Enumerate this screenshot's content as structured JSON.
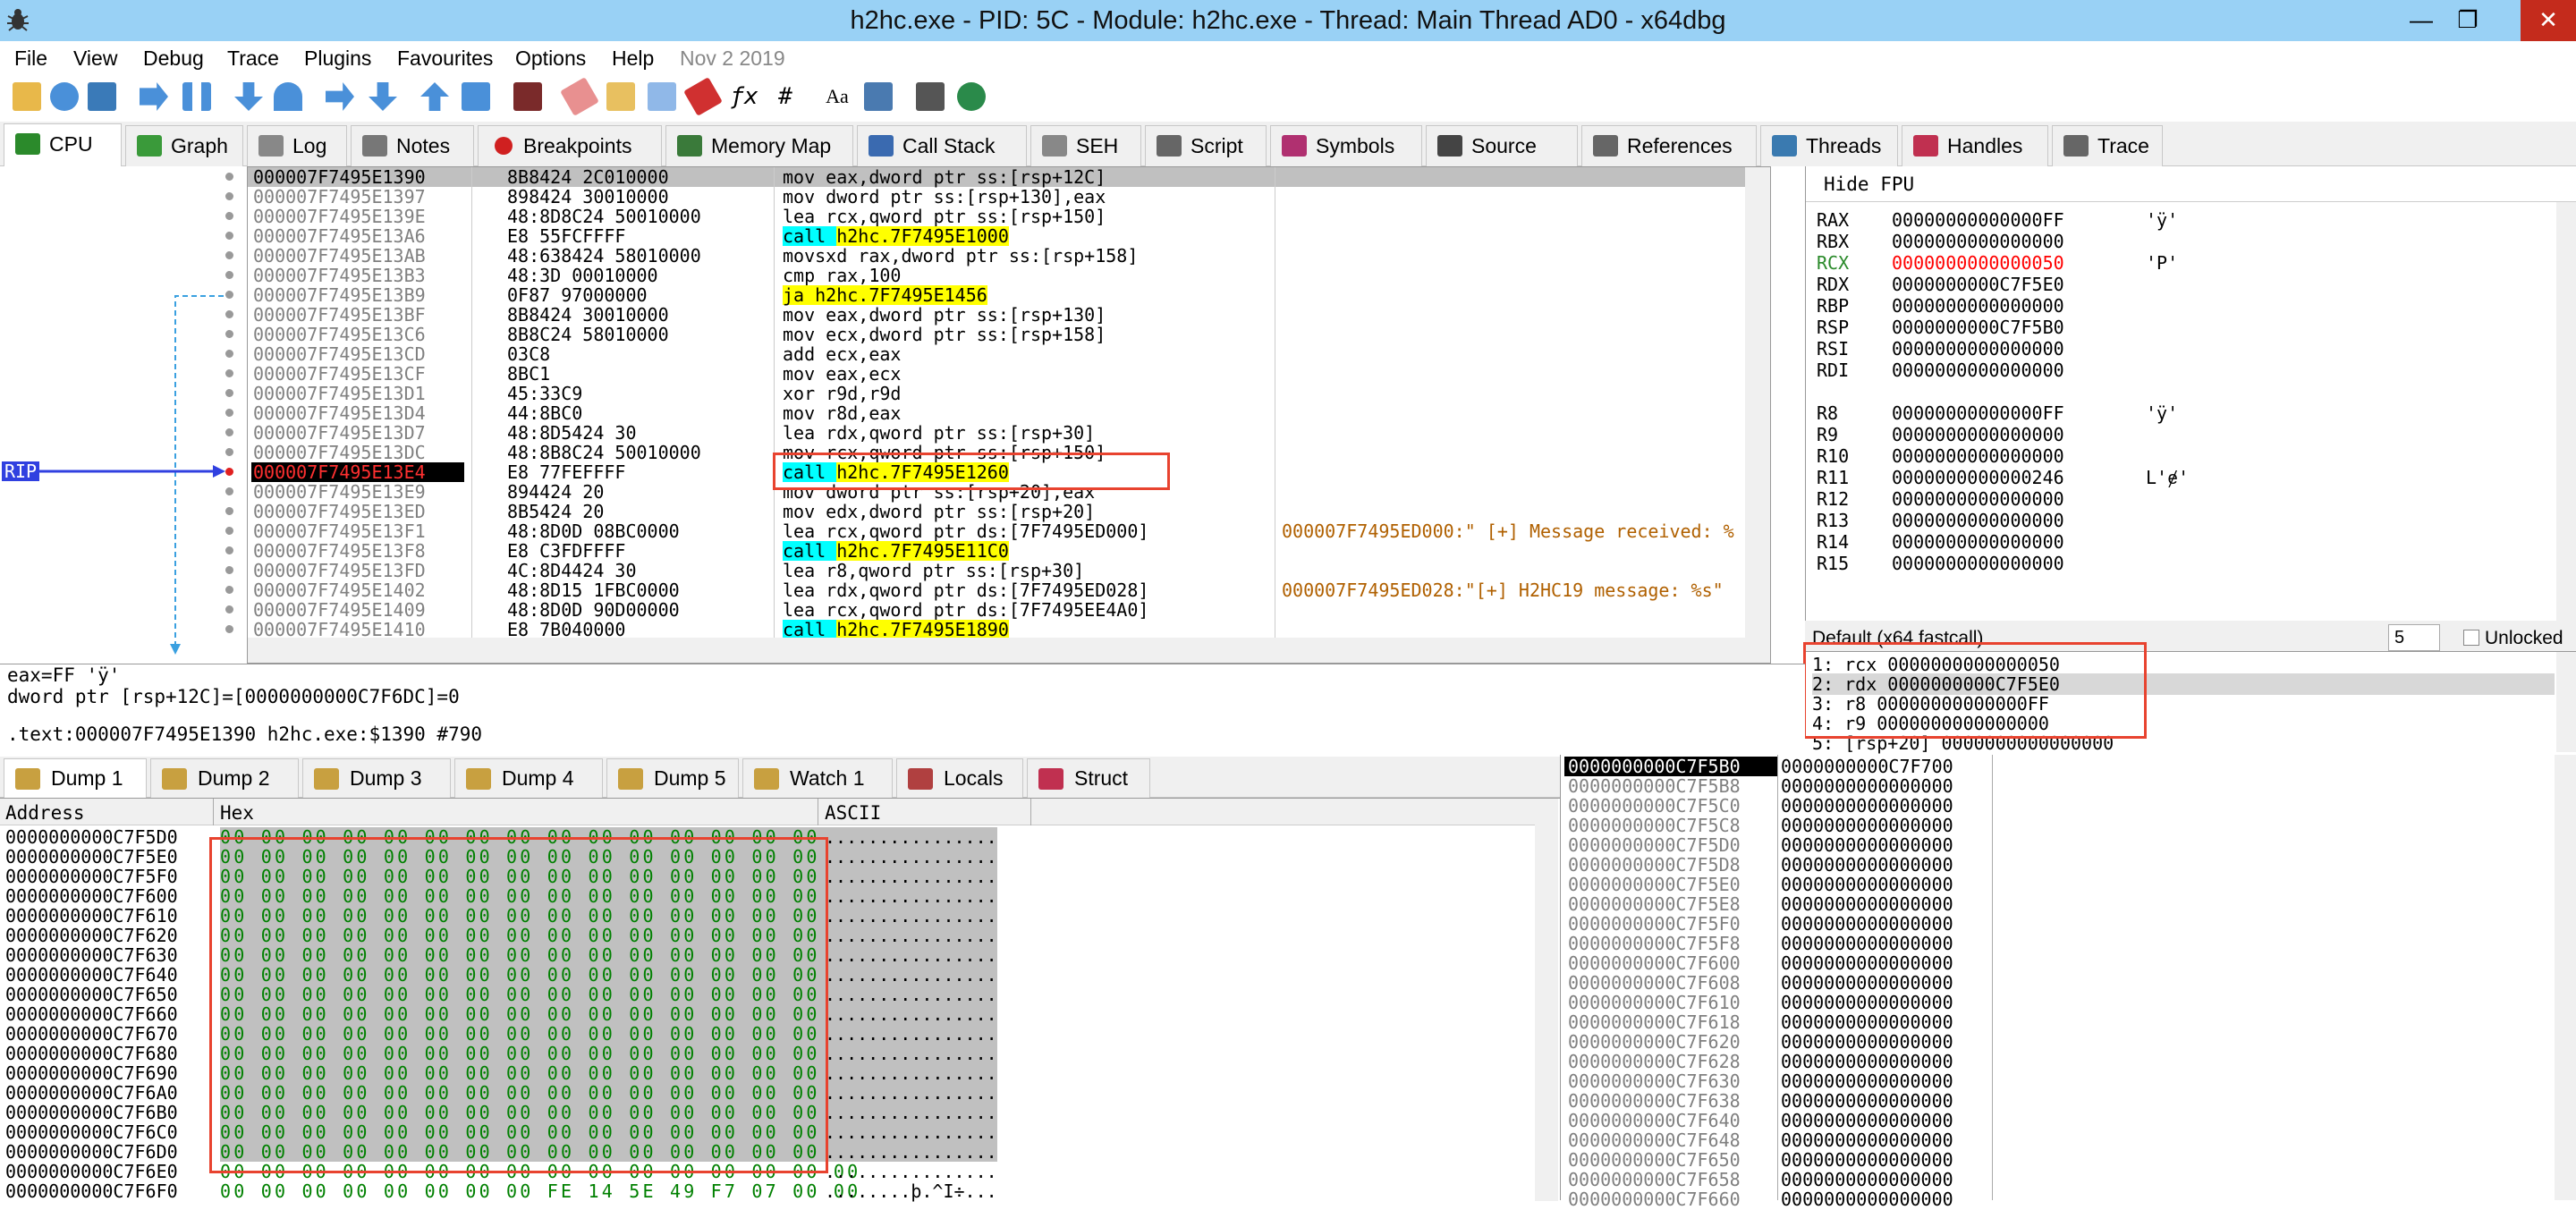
{
  "window": {
    "title": "h2hc.exe - PID: 5C - Module: h2hc.exe - Thread: Main Thread AD0 - x64dbg",
    "minimize": "—",
    "maximize": "❐",
    "close": "✕"
  },
  "menu": {
    "items": [
      "File",
      "View",
      "Debug",
      "Trace",
      "Plugins",
      "Favourites",
      "Options",
      "Help"
    ],
    "date": "Nov 2 2019"
  },
  "tabs": [
    {
      "label": "CPU",
      "color": "#2b8a2b"
    },
    {
      "label": "Graph",
      "color": "#3a9a3a"
    },
    {
      "label": "Log",
      "color": "#888888"
    },
    {
      "label": "Notes",
      "color": "#777777"
    },
    {
      "label": "Breakpoints",
      "color": "#d02020"
    },
    {
      "label": "Memory Map",
      "color": "#3a7a3a"
    },
    {
      "label": "Call Stack",
      "color": "#3a6ab0"
    },
    {
      "label": "SEH",
      "color": "#888888"
    },
    {
      "label": "Script",
      "color": "#666666"
    },
    {
      "label": "Symbols",
      "color": "#b03070"
    },
    {
      "label": "Source",
      "color": "#444444"
    },
    {
      "label": "References",
      "color": "#666666"
    },
    {
      "label": "Threads",
      "color": "#3a7ab0"
    },
    {
      "label": "Handles",
      "color": "#c03050"
    },
    {
      "label": "Trace",
      "color": "#666666"
    }
  ],
  "disasm": {
    "rip_label": "RIP",
    "rows": [
      {
        "addr": "000007F7495E1390",
        "bytes": "8B8424 2C010000",
        "mnem": "mov eax,dword ptr ss:[rsp+12C]",
        "comment": "",
        "style": "current"
      },
      {
        "addr": "000007F7495E1397",
        "bytes": "898424 30010000",
        "mnem": "mov dword ptr ss:[rsp+130],eax",
        "comment": "",
        "style": ""
      },
      {
        "addr": "000007F7495E139E",
        "bytes": "48:8D8C24 50010000",
        "mnem": "lea rcx,qword ptr ss:[rsp+150]",
        "comment": "",
        "style": ""
      },
      {
        "addr": "000007F7495E13A6",
        "bytes": "E8 55FCFFFF",
        "mnem": "call h2hc.7F7495E1000",
        "comment": "",
        "style": "call"
      },
      {
        "addr": "000007F7495E13AB",
        "bytes": "48:638424 58010000",
        "mnem": "movsxd rax,dword ptr ss:[rsp+158]",
        "comment": "",
        "style": ""
      },
      {
        "addr": "000007F7495E13B3",
        "bytes": "48:3D 00010000",
        "mnem": "cmp rax,100",
        "comment": "",
        "style": ""
      },
      {
        "addr": "000007F7495E13B9",
        "bytes": "0F87 97000000",
        "mnem": "ja h2hc.7F7495E1456",
        "comment": "",
        "style": "jump"
      },
      {
        "addr": "000007F7495E13BF",
        "bytes": "8B8424 30010000",
        "mnem": "mov eax,dword ptr ss:[rsp+130]",
        "comment": "",
        "style": ""
      },
      {
        "addr": "000007F7495E13C6",
        "bytes": "8B8C24 58010000",
        "mnem": "mov ecx,dword ptr ss:[rsp+158]",
        "comment": "",
        "style": ""
      },
      {
        "addr": "000007F7495E13CD",
        "bytes": "03C8",
        "mnem": "add ecx,eax",
        "comment": "",
        "style": ""
      },
      {
        "addr": "000007F7495E13CF",
        "bytes": "8BC1",
        "mnem": "mov eax,ecx",
        "comment": "",
        "style": ""
      },
      {
        "addr": "000007F7495E13D1",
        "bytes": "45:33C9",
        "mnem": "xor r9d,r9d",
        "comment": "",
        "style": ""
      },
      {
        "addr": "000007F7495E13D4",
        "bytes": "44:8BC0",
        "mnem": "mov r8d,eax",
        "comment": "",
        "style": ""
      },
      {
        "addr": "000007F7495E13D7",
        "bytes": "48:8D5424 30",
        "mnem": "lea rdx,qword ptr ss:[rsp+30]",
        "comment": "",
        "style": ""
      },
      {
        "addr": "000007F7495E13DC",
        "bytes": "48:8B8C24 50010000",
        "mnem": "mov rcx,qword ptr ss:[rsp+150]",
        "comment": "",
        "style": ""
      },
      {
        "addr": "000007F7495E13E4",
        "bytes": "E8 77FEFFFF",
        "mnem": "call h2hc.7F7495E1260",
        "comment": "",
        "style": "rip"
      },
      {
        "addr": "000007F7495E13E9",
        "bytes": "894424 20",
        "mnem": "mov dword ptr ss:[rsp+20],eax",
        "comment": "",
        "style": ""
      },
      {
        "addr": "000007F7495E13ED",
        "bytes": "8B5424 20",
        "mnem": "mov edx,dword ptr ss:[rsp+20]",
        "comment": "",
        "style": ""
      },
      {
        "addr": "000007F7495E13F1",
        "bytes": "48:8D0D 08BC0000",
        "mnem": "lea rcx,qword ptr ds:[7F7495ED000]",
        "comment": "000007F7495ED000:\" [+] Message received: %",
        "style": ""
      },
      {
        "addr": "000007F7495E13F8",
        "bytes": "E8 C3FDFFFF",
        "mnem": "call h2hc.7F7495E11C0",
        "comment": "",
        "style": "call"
      },
      {
        "addr": "000007F7495E13FD",
        "bytes": "4C:8D4424 30",
        "mnem": "lea r8,qword ptr ss:[rsp+30]",
        "comment": "",
        "style": ""
      },
      {
        "addr": "000007F7495E1402",
        "bytes": "48:8D15 1FBC0000",
        "mnem": "lea rdx,qword ptr ds:[7F7495ED028]",
        "comment": "000007F7495ED028:\"[+] H2HC19 message: %s\"",
        "style": ""
      },
      {
        "addr": "000007F7495E1409",
        "bytes": "48:8D0D 90D00000",
        "mnem": "lea rcx,qword ptr ds:[7F7495EE4A0]",
        "comment": "",
        "style": ""
      },
      {
        "addr": "000007F7495E1410",
        "bytes": "E8 7B040000",
        "mnem": "call h2hc.7F7495E1890",
        "comment": "",
        "style": "call"
      }
    ]
  },
  "registers": {
    "header": "Hide FPU",
    "rows": [
      {
        "name": "RAX",
        "value": "00000000000000FF",
        "extra": "'ÿ'",
        "changed": false
      },
      {
        "name": "RBX",
        "value": "0000000000000000",
        "extra": "",
        "changed": false
      },
      {
        "name": "RCX",
        "value": "0000000000000050",
        "extra": "'P'",
        "changed": true
      },
      {
        "name": "RDX",
        "value": "0000000000C7F5E0",
        "extra": "",
        "changed": false
      },
      {
        "name": "RBP",
        "value": "0000000000000000",
        "extra": "",
        "changed": false
      },
      {
        "name": "RSP",
        "value": "0000000000C7F5B0",
        "extra": "",
        "changed": false
      },
      {
        "name": "RSI",
        "value": "0000000000000000",
        "extra": "",
        "changed": false
      },
      {
        "name": "RDI",
        "value": "0000000000000000",
        "extra": "",
        "changed": false
      },
      {
        "name": "",
        "value": "",
        "extra": "",
        "changed": false
      },
      {
        "name": "R8",
        "value": "00000000000000FF",
        "extra": "'ÿ'",
        "changed": false
      },
      {
        "name": "R9",
        "value": "0000000000000000",
        "extra": "",
        "changed": false
      },
      {
        "name": "R10",
        "value": "0000000000000000",
        "extra": "",
        "changed": false
      },
      {
        "name": "R11",
        "value": "0000000000000246",
        "extra": "L'ɇ'",
        "changed": false
      },
      {
        "name": "R12",
        "value": "0000000000000000",
        "extra": "",
        "changed": false
      },
      {
        "name": "R13",
        "value": "0000000000000000",
        "extra": "",
        "changed": false
      },
      {
        "name": "R14",
        "value": "0000000000000000",
        "extra": "",
        "changed": false
      },
      {
        "name": "R15",
        "value": "0000000000000000",
        "extra": "",
        "changed": false
      }
    ],
    "callconv": "Default (x64 fastcall)",
    "argcount": "5",
    "unlocked": "Unlocked",
    "args": [
      "1: rcx 0000000000000050",
      "2: rdx 0000000000C7F5E0",
      "3: r8 00000000000000FF",
      "4: r9 0000000000000000",
      "5: [rsp+20] 0000000000000000"
    ]
  },
  "info": {
    "line1": "eax=FF 'ÿ'",
    "line2": "dword ptr [rsp+12C]=[0000000000C7F6DC]=0",
    "line3": ".text:000007F7495E1390 h2hc.exe:$1390 #790"
  },
  "dump_tabs": [
    "Dump 1",
    "Dump 2",
    "Dump 3",
    "Dump 4",
    "Dump 5",
    "Watch 1",
    "Locals",
    "Struct"
  ],
  "dump": {
    "col_address": "Address",
    "col_hex": "Hex",
    "col_ascii": "ASCII",
    "rows": [
      {
        "addr": "0000000000C7F5D0",
        "hex": "00 00 00 00 00 00 00 00 00 00 00 00 00 00 00 00",
        "ascii": "................"
      },
      {
        "addr": "0000000000C7F5E0",
        "hex": "00 00 00 00 00 00 00 00 00 00 00 00 00 00 00 00",
        "ascii": "................"
      },
      {
        "addr": "0000000000C7F5F0",
        "hex": "00 00 00 00 00 00 00 00 00 00 00 00 00 00 00 00",
        "ascii": "................"
      },
      {
        "addr": "0000000000C7F600",
        "hex": "00 00 00 00 00 00 00 00 00 00 00 00 00 00 00 00",
        "ascii": "................"
      },
      {
        "addr": "0000000000C7F610",
        "hex": "00 00 00 00 00 00 00 00 00 00 00 00 00 00 00 00",
        "ascii": "................"
      },
      {
        "addr": "0000000000C7F620",
        "hex": "00 00 00 00 00 00 00 00 00 00 00 00 00 00 00 00",
        "ascii": "................"
      },
      {
        "addr": "0000000000C7F630",
        "hex": "00 00 00 00 00 00 00 00 00 00 00 00 00 00 00 00",
        "ascii": "................"
      },
      {
        "addr": "0000000000C7F640",
        "hex": "00 00 00 00 00 00 00 00 00 00 00 00 00 00 00 00",
        "ascii": "................"
      },
      {
        "addr": "0000000000C7F650",
        "hex": "00 00 00 00 00 00 00 00 00 00 00 00 00 00 00 00",
        "ascii": "................"
      },
      {
        "addr": "0000000000C7F660",
        "hex": "00 00 00 00 00 00 00 00 00 00 00 00 00 00 00 00",
        "ascii": "................"
      },
      {
        "addr": "0000000000C7F670",
        "hex": "00 00 00 00 00 00 00 00 00 00 00 00 00 00 00 00",
        "ascii": "................"
      },
      {
        "addr": "0000000000C7F680",
        "hex": "00 00 00 00 00 00 00 00 00 00 00 00 00 00 00 00",
        "ascii": "................"
      },
      {
        "addr": "0000000000C7F690",
        "hex": "00 00 00 00 00 00 00 00 00 00 00 00 00 00 00 00",
        "ascii": "................"
      },
      {
        "addr": "0000000000C7F6A0",
        "hex": "00 00 00 00 00 00 00 00 00 00 00 00 00 00 00 00",
        "ascii": "................"
      },
      {
        "addr": "0000000000C7F6B0",
        "hex": "00 00 00 00 00 00 00 00 00 00 00 00 00 00 00 00",
        "ascii": "................"
      },
      {
        "addr": "0000000000C7F6C0",
        "hex": "00 00 00 00 00 00 00 00 00 00 00 00 00 00 00 00",
        "ascii": "................"
      },
      {
        "addr": "0000000000C7F6D0",
        "hex": "00 00 00 00 00 00 00 00 00 00 00 00 00 00 00 00",
        "ascii": "................"
      },
      {
        "addr": "0000000000C7F6E0",
        "hex": "00 00 00 00 00 00 00 00 00 00 00 00 00 00 00 00",
        "ascii": "................"
      },
      {
        "addr": "0000000000C7F6F0",
        "hex": "00 00 00 00 00 00 00 00 FE 14 5E 49 F7 07 00 00",
        "ascii": "........þ.^I÷..."
      }
    ]
  },
  "stack": {
    "header_addr": "0000000000C7F5B0",
    "header_val": "0000000000C7F700",
    "rows": [
      {
        "addr": "0000000000C7F5B8",
        "val": "0000000000000000"
      },
      {
        "addr": "0000000000C7F5C0",
        "val": "0000000000000000"
      },
      {
        "addr": "0000000000C7F5C8",
        "val": "0000000000000000"
      },
      {
        "addr": "0000000000C7F5D0",
        "val": "0000000000000000"
      },
      {
        "addr": "0000000000C7F5D8",
        "val": "0000000000000000"
      },
      {
        "addr": "0000000000C7F5E0",
        "val": "0000000000000000"
      },
      {
        "addr": "0000000000C7F5E8",
        "val": "0000000000000000"
      },
      {
        "addr": "0000000000C7F5F0",
        "val": "0000000000000000"
      },
      {
        "addr": "0000000000C7F5F8",
        "val": "0000000000000000"
      },
      {
        "addr": "0000000000C7F600",
        "val": "0000000000000000"
      },
      {
        "addr": "0000000000C7F608",
        "val": "0000000000000000"
      },
      {
        "addr": "0000000000C7F610",
        "val": "0000000000000000"
      },
      {
        "addr": "0000000000C7F618",
        "val": "0000000000000000"
      },
      {
        "addr": "0000000000C7F620",
        "val": "0000000000000000"
      },
      {
        "addr": "0000000000C7F628",
        "val": "0000000000000000"
      },
      {
        "addr": "0000000000C7F630",
        "val": "0000000000000000"
      },
      {
        "addr": "0000000000C7F638",
        "val": "0000000000000000"
      },
      {
        "addr": "0000000000C7F640",
        "val": "0000000000000000"
      },
      {
        "addr": "0000000000C7F648",
        "val": "0000000000000000"
      },
      {
        "addr": "0000000000C7F650",
        "val": "0000000000000000"
      },
      {
        "addr": "0000000000C7F658",
        "val": "0000000000000000"
      },
      {
        "addr": "0000000000C7F660",
        "val": "0000000000000000"
      }
    ]
  },
  "colors": {
    "title_bar": "#99d1f5",
    "address_gray": "#808080",
    "changed_register": "#ff0000",
    "dump_hex_green": "#008000",
    "highlight_box": "#e8432f",
    "call_cyan": "#00ffff",
    "jump_yellow": "#ffff00"
  }
}
